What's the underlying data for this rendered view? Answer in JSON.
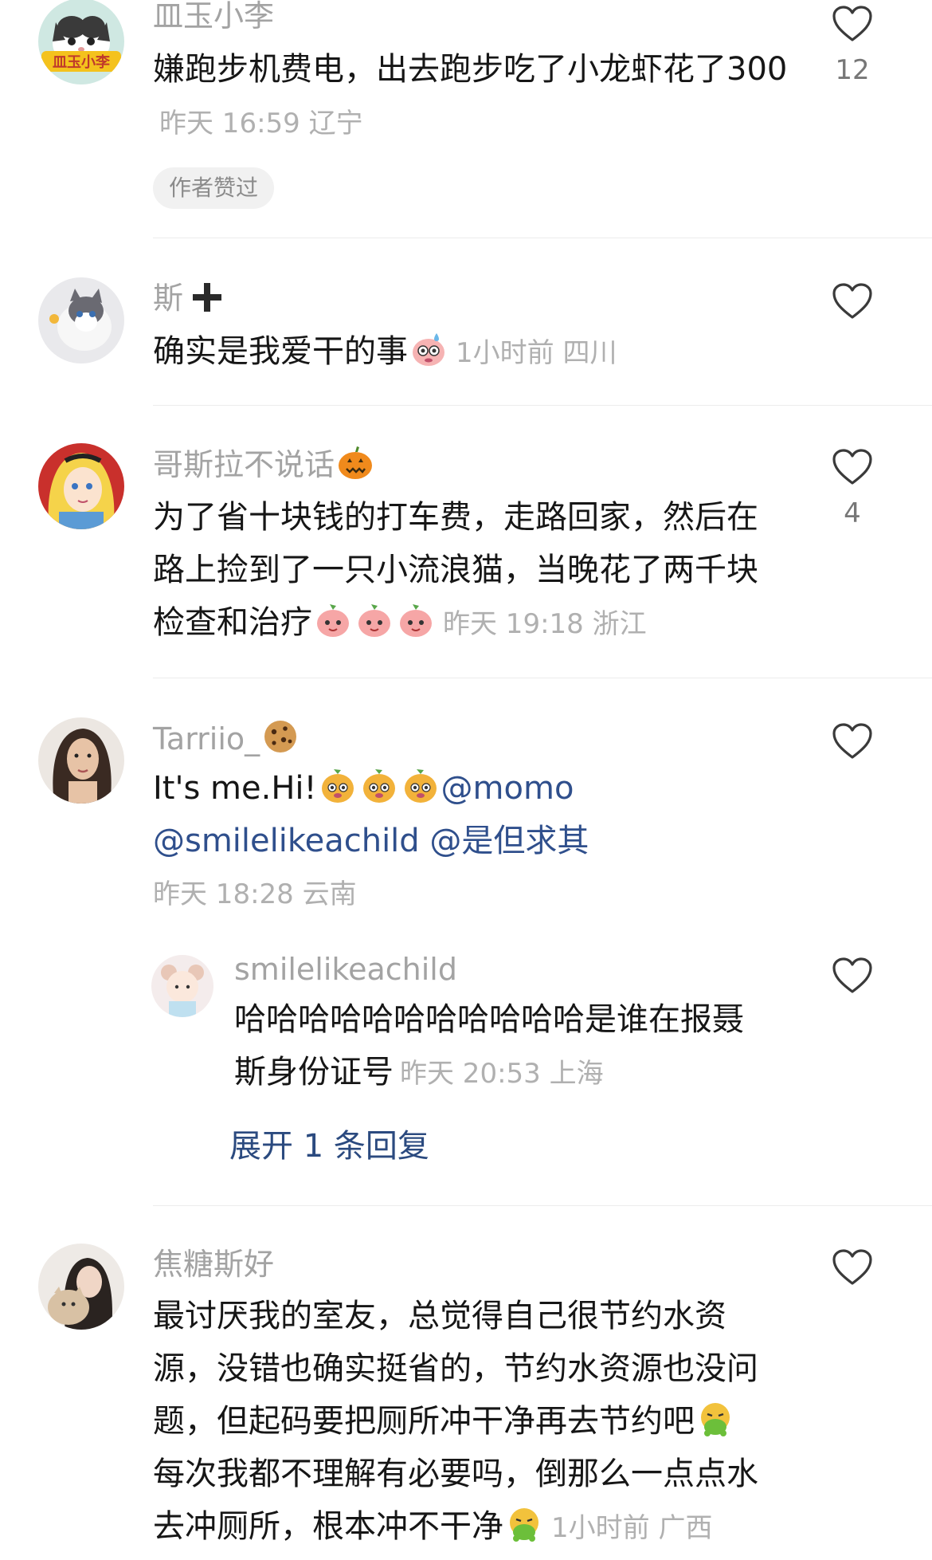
{
  "comments": [
    {
      "username": "皿玉小李",
      "avatar_label": "皿玉小李",
      "text": "嫌跑步机费电，出去跑步吃了小龙虾花了300",
      "meta": "昨天 16:59 辽宁",
      "badge": "作者赞过",
      "likes": "12"
    },
    {
      "username": "斯",
      "text": "确实是我爱干的事",
      "meta": "1小时前 四川",
      "likes": ""
    },
    {
      "username": "哥斯拉不说话",
      "text_line1": "为了省十块钱的打车费，走路回家，然后在",
      "text_line2": "路上捡到了一只小流浪猫，当晚花了两千块",
      "text_line3": "检查和治疗",
      "meta": "昨天 19:18 浙江",
      "likes": "4"
    },
    {
      "username": "Tarriio_",
      "text_prefix": "It's me.Hi!",
      "mention1": "@momo",
      "mention2": "@smilelikeachild",
      "mention3": "@是但求其",
      "meta": "昨天 18:28 云南",
      "likes": ""
    },
    {
      "username": "焦糖斯好",
      "text_line1": "最讨厌我的室友，总觉得自己很节约水资",
      "text_line2": "源，没错也确实挺省的，节约水资源也没问",
      "text_line3": "题，但起码要把厕所冲干净再去节约吧",
      "text_line4": "每次我都不理解有必要吗，倒那么一点点水",
      "text_line5": "去冲厕所，根本冲不干净",
      "meta": "1小时前 广西",
      "likes": ""
    }
  ],
  "reply": {
    "username": "smilelikeachild",
    "text_line1": "哈哈哈哈哈哈哈哈哈哈哈是谁在报聂",
    "text_line2": "斯身份证号",
    "meta": "昨天 20:53 上海",
    "likes": ""
  },
  "expand_replies": "展开 1 条回复",
  "icons": {
    "like": "heart-outline-icon",
    "add": "plus-icon",
    "emoji_sweat": "sweating-face-emoji",
    "emoji_pumpkin": "pumpkin-emoji",
    "emoji_peach": "peach-face-emoji",
    "emoji_cookie": "cookie-emoji",
    "emoji_dog": "dog-face-emoji",
    "emoji_vomit": "vomit-face-emoji"
  },
  "colors": {
    "mention": "#2f4f8c",
    "meta": "#b0b0b0",
    "username": "#a3a3a3"
  }
}
